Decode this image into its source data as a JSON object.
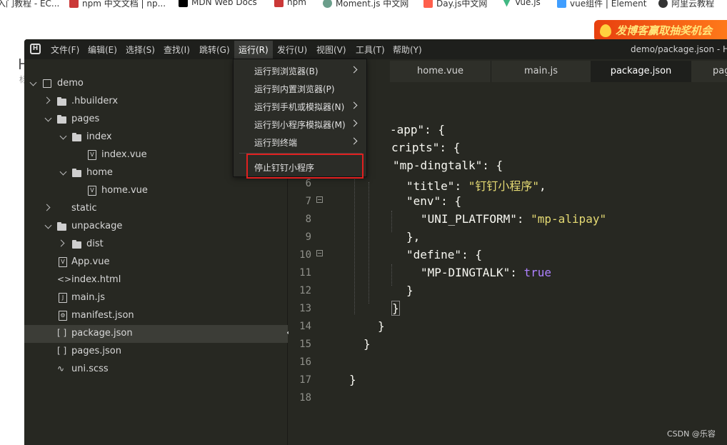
{
  "bookmarks": [
    {
      "label": "入门教程 - EC...",
      "icon": "page-icon",
      "color": "#999999"
    },
    {
      "label": "npm 中文文档 | np...",
      "icon": "npm-icon",
      "color": "#cb3837"
    },
    {
      "label": "MDN Web Docs",
      "icon": "mdn-icon",
      "color": "#000000"
    },
    {
      "label": "npm",
      "icon": "npm-icon",
      "color": "#cb3837"
    },
    {
      "label": "Moment.js 中文网",
      "icon": "moment-icon",
      "color": "#6b9e8b"
    },
    {
      "label": "Day.js中文网",
      "icon": "dayjs-icon",
      "color": "#ff5f4c"
    },
    {
      "label": "Vue.js",
      "icon": "vue-icon",
      "color": "#41b883"
    },
    {
      "label": "vue组件 | Element",
      "icon": "element-icon",
      "color": "#409eff"
    },
    {
      "label": "阿里云教程",
      "icon": "github-icon",
      "color": "#333333"
    }
  ],
  "banner": {
    "text": "发博客赢取抽奖机会"
  },
  "background_page": {
    "heading": "H",
    "sub": "标"
  },
  "ide": {
    "window_title": "demo/package.json - H",
    "menu": [
      "文件(F)",
      "编辑(E)",
      "选择(S)",
      "查找(I)",
      "跳转(G)",
      "运行(R)",
      "发行(U)",
      "视图(V)",
      "工具(T)",
      "帮助(Y)"
    ],
    "active_menu": "运行(R)",
    "run_menu": [
      {
        "label": "运行到浏览器(B)",
        "submenu": true
      },
      {
        "label": "运行到内置浏览器(P)",
        "submenu": false
      },
      {
        "label": "运行到手机或模拟器(N)",
        "submenu": true
      },
      {
        "label": "运行到小程序模拟器(M)",
        "submenu": true
      },
      {
        "label": "运行到终端",
        "submenu": true
      },
      {
        "label": "停止钉钉小程序",
        "submenu": false,
        "highlighted": true
      }
    ],
    "file_tree": [
      {
        "label": "demo",
        "type": "project",
        "expanded": true
      },
      {
        "label": ".hbuilderx",
        "type": "folder",
        "expanded": false
      },
      {
        "label": "pages",
        "type": "folder",
        "expanded": true
      },
      {
        "label": "index",
        "type": "folder",
        "expanded": true
      },
      {
        "label": "index.vue",
        "type": "vue"
      },
      {
        "label": "home",
        "type": "folder",
        "expanded": true
      },
      {
        "label": "home.vue",
        "type": "vue"
      },
      {
        "label": "static",
        "type": "folder",
        "expanded": false
      },
      {
        "label": "unpackage",
        "type": "folder",
        "expanded": true
      },
      {
        "label": "dist",
        "type": "folder",
        "expanded": false
      },
      {
        "label": "App.vue",
        "type": "vue"
      },
      {
        "label": "index.html",
        "type": "html"
      },
      {
        "label": "main.js",
        "type": "js"
      },
      {
        "label": "manifest.json",
        "type": "manifest"
      },
      {
        "label": "package.json",
        "type": "json",
        "selected": true
      },
      {
        "label": "pages.json",
        "type": "json"
      },
      {
        "label": "uni.scss",
        "type": "scss"
      }
    ],
    "tabs": [
      "home.vue",
      "main.js",
      "package.json",
      "pag"
    ],
    "active_tab": "package.json",
    "code_lines": {
      "l3": "-app\": {",
      "l4": "cripts\": {",
      "l5_key": "\"mp-dingtalk\"",
      "l5_rest": ": {",
      "l6_key": "\"title\"",
      "l6_val": "\"钉钉小程序\"",
      "l7_key": "\"env\"",
      "l8_key": "\"UNI_PLATFORM\"",
      "l8_val": "\"mp-alipay\"",
      "l9": "},",
      "l10_key": "\"define\"",
      "l11_key": "\"MP-DINGTALK\"",
      "l11_val": "true",
      "l12": "}",
      "l13": "}",
      "l14": "}",
      "l15": "}",
      "l17": "}"
    },
    "line_numbers": [
      "6",
      "7",
      "8",
      "9",
      "10",
      "11",
      "12",
      "13",
      "14",
      "15",
      "16",
      "17",
      "18"
    ]
  },
  "watermark": "CSDN @乐容"
}
